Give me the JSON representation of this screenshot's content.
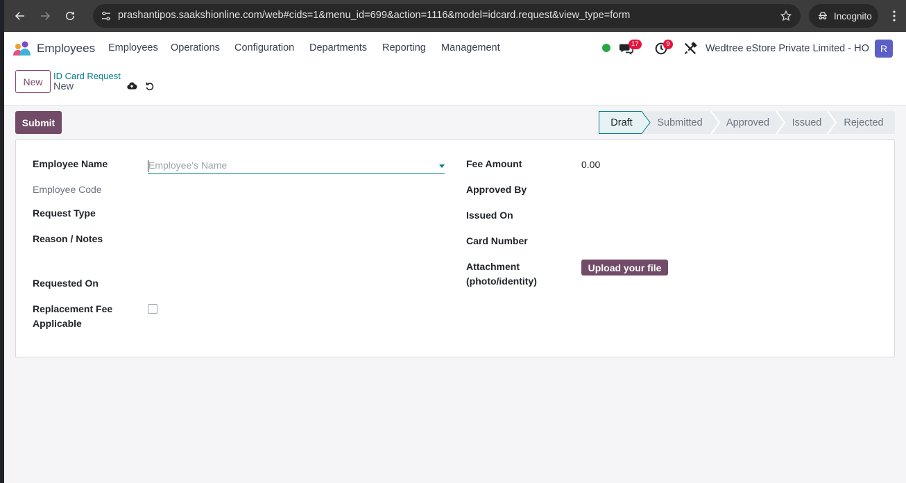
{
  "browser": {
    "url": "prashantipos.saakshionline.com/web#cids=1&menu_id=699&action=1116&model=idcard.request&view_type=form",
    "incognito_label": "Incognito"
  },
  "navbar": {
    "app_name": "Employees",
    "menus": [
      "Employees",
      "Operations",
      "Configuration",
      "Departments",
      "Reporting",
      "Management"
    ],
    "messages_badge": "17",
    "activities_badge": "9",
    "company": "Wedtree eStore Private Limited - HO",
    "avatar_letter": "R",
    "status_color": "#28a745"
  },
  "control_panel": {
    "new_label": "New",
    "breadcrumb": "ID Card Request",
    "record_name": "New"
  },
  "statusbar": {
    "submit_label": "Submit",
    "stages": [
      "Draft",
      "Submitted",
      "Approved",
      "Issued",
      "Rejected"
    ],
    "active_stage": "Draft"
  },
  "form": {
    "left": {
      "employee_name_label": "Employee Name",
      "employee_name_placeholder": "Employee's Name",
      "employee_code_label": "Employee Code",
      "request_type_label": "Request Type",
      "reason_label": "Reason / Notes",
      "requested_on_label": "Requested On",
      "replacement_fee_label_1": "Replacement Fee",
      "replacement_fee_label_2": "Applicable",
      "replacement_fee_checked": false
    },
    "right": {
      "fee_amount_label": "Fee Amount",
      "fee_amount_value": "0.00",
      "approved_by_label": "Approved By",
      "issued_on_label": "Issued On",
      "card_number_label": "Card Number",
      "attachment_label_1": "Attachment",
      "attachment_label_2": "(photo/identity)",
      "upload_label": "Upload your file"
    }
  },
  "colors": {
    "brand": "#714b67",
    "link": "#017e84"
  }
}
